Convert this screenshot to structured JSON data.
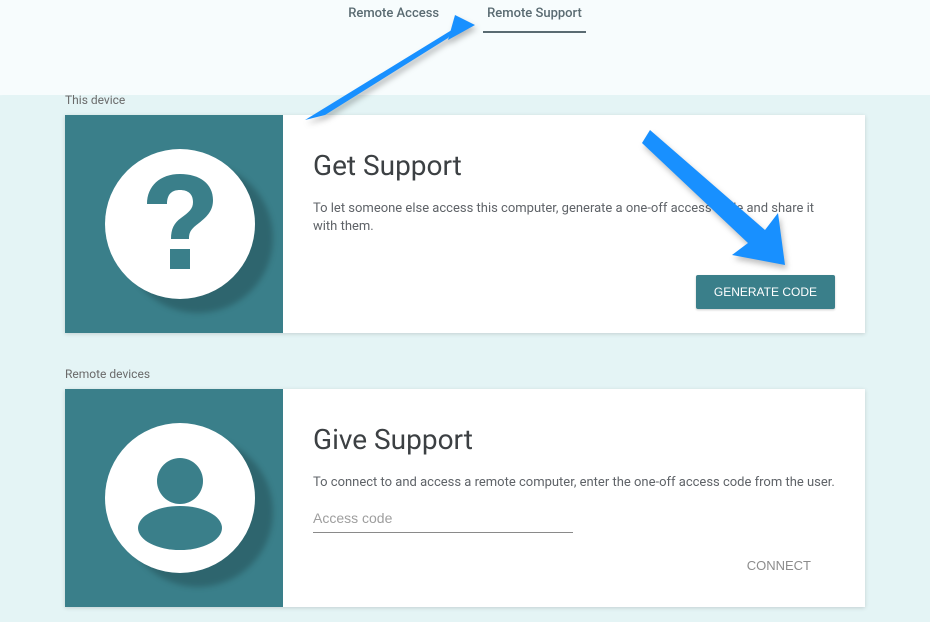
{
  "tabs": {
    "remote_access": "Remote Access",
    "remote_support": "Remote Support"
  },
  "sections": {
    "this_device": "This device",
    "remote_devices": "Remote devices"
  },
  "get_support": {
    "title": "Get Support",
    "description": "To let someone else access this computer, generate a one-off access code and share it with them.",
    "button": "GENERATE CODE"
  },
  "give_support": {
    "title": "Give Support",
    "description": "To connect to and access a remote computer, enter the one-off access code from the user.",
    "placeholder": "Access code",
    "button": "CONNECT"
  },
  "colors": {
    "teal": "#3a7f8a",
    "arrow_blue": "#1890ff"
  }
}
